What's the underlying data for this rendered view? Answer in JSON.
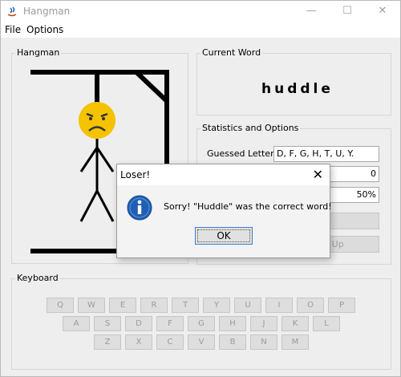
{
  "window": {
    "title": "Hangman",
    "minimize_glyph": "—",
    "maximize_glyph": "☐",
    "close_glyph": "✕"
  },
  "menu": {
    "items": [
      "File",
      "Options"
    ]
  },
  "hangman_panel": {
    "title": "Hangman"
  },
  "current_word_panel": {
    "title": "Current Word",
    "word": "huddle"
  },
  "stats_panel": {
    "title": "Statistics and Options",
    "guessed_letters_label": "Guessed Letters",
    "guessed_letters_value": "D, F, G, H, T, U, Y.",
    "wins_value": "0",
    "percent_value": "50%",
    "give_up_label": "Give Up"
  },
  "keyboard": {
    "title": "Keyboard",
    "rows": [
      [
        "Q",
        "W",
        "E",
        "R",
        "T",
        "Y",
        "U",
        "I",
        "O",
        "P"
      ],
      [
        "A",
        "S",
        "D",
        "F",
        "G",
        "H",
        "J",
        "K",
        "L"
      ],
      [
        "Z",
        "X",
        "C",
        "V",
        "B",
        "N",
        "M"
      ]
    ]
  },
  "dialog": {
    "title": "Loser!",
    "close_glyph": "✕",
    "icon": "info-icon",
    "message": "Sorry! \"Huddle\" was the correct word!",
    "ok_label": "OK"
  },
  "colors": {
    "face": "#f5c200",
    "gallows": "#000000",
    "info_blue": "#1f5fb4"
  }
}
